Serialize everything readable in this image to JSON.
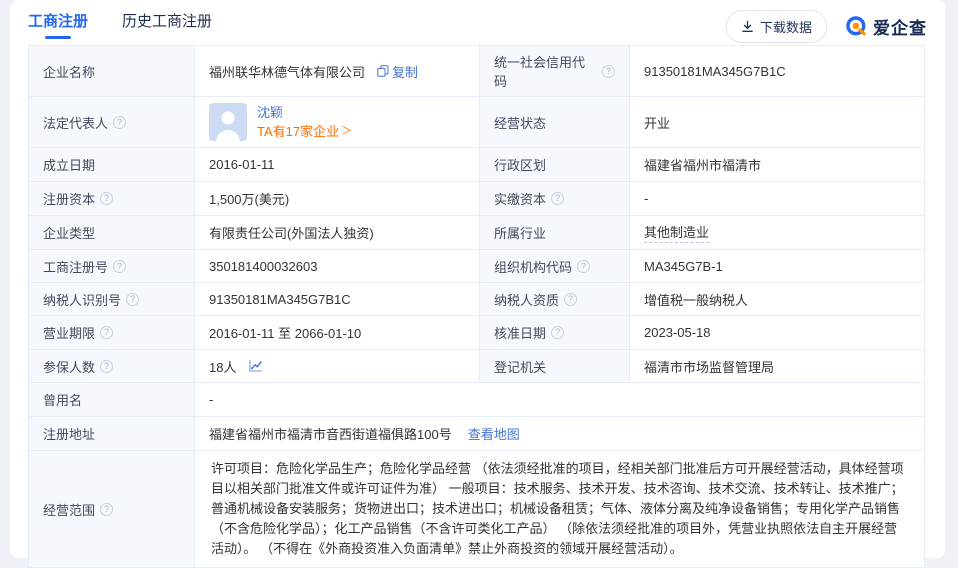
{
  "colors": {
    "accent_blue": "#2468f2",
    "link_blue": "#4674d1",
    "accent_orange": "#ff6b00",
    "label_bg": "#f5f8fd",
    "border": "#e7edf6",
    "brand_orange": "#ff9000"
  },
  "tabs": [
    {
      "label": "工商注册",
      "active": true
    },
    {
      "label": "历史工商注册",
      "active": false
    }
  ],
  "toolbar": {
    "download_label": "下载数据"
  },
  "brand": {
    "name": "爱企查"
  },
  "icons": {
    "help": "?",
    "chevron_right": "＞"
  },
  "fields": {
    "company_name": {
      "label": "企业名称",
      "value": "福州联华林德气体有限公司",
      "copy_label": "复制"
    },
    "credit_code": {
      "label": "统一社会信用代码",
      "value": "91350181MA345G7B1C"
    },
    "legal_rep": {
      "label": "法定代表人",
      "name": "沈颖",
      "companies_text": "TA有17家企业"
    },
    "status": {
      "label": "经营状态",
      "value": "开业"
    },
    "est_date": {
      "label": "成立日期",
      "value": "2016-01-11"
    },
    "region": {
      "label": "行政区划",
      "value": "福建省福州市福清市"
    },
    "reg_capital": {
      "label": "注册资本",
      "value": "1,500万(美元)"
    },
    "paid_capital": {
      "label": "实缴资本",
      "value": "-"
    },
    "company_type": {
      "label": "企业类型",
      "value": "有限责任公司(外国法人独资)"
    },
    "industry": {
      "label": "所属行业",
      "value": "其他制造业"
    },
    "reg_number": {
      "label": "工商注册号",
      "value": "350181400032603"
    },
    "org_code": {
      "label": "组织机构代码",
      "value": "MA345G7B-1"
    },
    "taxpayer_id": {
      "label": "纳税人识别号",
      "value": "91350181MA345G7B1C"
    },
    "taxpayer_qualification": {
      "label": "纳税人资质",
      "value": "增值税一般纳税人"
    },
    "business_term": {
      "label": "营业期限",
      "value": "2016-01-11 至 2066-01-10"
    },
    "approval_date": {
      "label": "核准日期",
      "value": "2023-05-18"
    },
    "insured_count": {
      "label": "参保人数",
      "value": "18人"
    },
    "registration_authority": {
      "label": "登记机关",
      "value": "福清市市场监督管理局"
    },
    "former_name": {
      "label": "曾用名",
      "value": "-"
    },
    "reg_address": {
      "label": "注册地址",
      "value": "福建省福州市福清市音西街道福俱路100号",
      "map_label": "查看地图"
    },
    "business_scope": {
      "label": "经营范围",
      "value": "许可项目：危险化学品生产；危险化学品经营 （依法须经批准的项目，经相关部门批准后方可开展经营活动，具体经营项目以相关部门批准文件或许可证件为准） 一般项目：技术服务、技术开发、技术咨询、技术交流、技术转让、技术推广；普通机械设备安装服务；货物进出口；技术进出口；机械设备租赁；气体、液体分离及纯净设备销售；专用化学产品销售（不含危险化学品）；化工产品销售（不含许可类化工产品） （除依法须经批准的项目外，凭营业执照依法自主开展经营活动）。 （不得在《外商投资准入负面清单》禁止外商投资的领域开展经营活动）。"
    }
  }
}
